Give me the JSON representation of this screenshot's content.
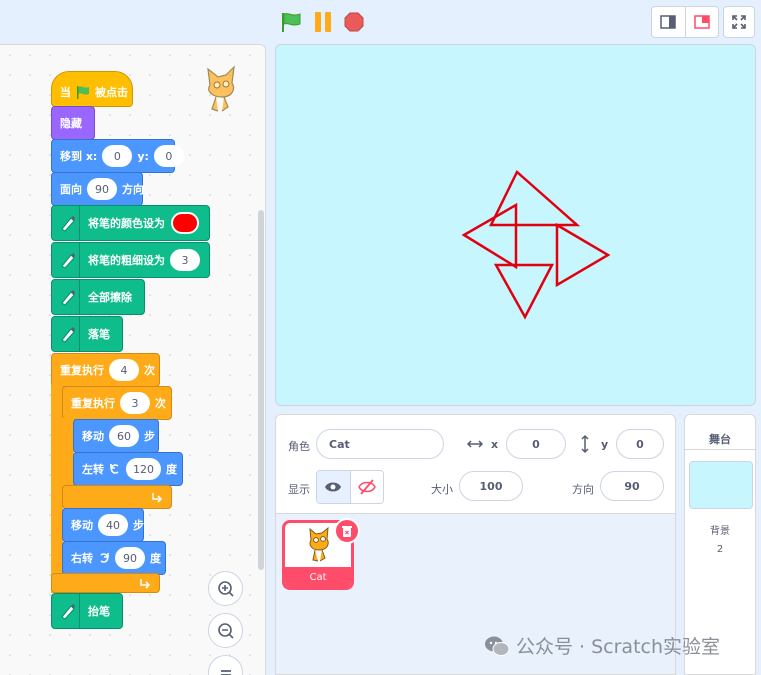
{
  "controls": {
    "green_flag": "green-flag-icon",
    "pause": "pause-icon",
    "stop": "stop-icon"
  },
  "blocks": {
    "when_flag": {
      "pre": "当",
      "post": "被点击"
    },
    "hide": "隐藏",
    "goto": {
      "label": "移到 x:",
      "x": "0",
      "ylabel": "y:",
      "y": "0"
    },
    "point": {
      "label": "面向",
      "value": "90",
      "suffix": "方向"
    },
    "set_color": {
      "label": "将笔的颜色设为",
      "color": "#ff0000"
    },
    "set_size": {
      "label": "将笔的粗细设为",
      "value": "3"
    },
    "erase": "全部擦除",
    "pen_down": "落笔",
    "repeat_outer": {
      "label": "重复执行",
      "value": "4",
      "suffix": "次"
    },
    "repeat_inner": {
      "label": "重复执行",
      "value": "3",
      "suffix": "次"
    },
    "move1": {
      "label": "移动",
      "value": "60",
      "suffix": "步"
    },
    "turn_left": {
      "label": "左转",
      "value": "120",
      "suffix": "度"
    },
    "move2": {
      "label": "移动",
      "value": "40",
      "suffix": "步"
    },
    "turn_right": {
      "label": "右转",
      "value": "90",
      "suffix": "度"
    },
    "pen_up": "抬笔"
  },
  "sprite_info": {
    "sprite_label": "角色",
    "sprite_name": "Cat",
    "x_label": "x",
    "x_value": "0",
    "y_label": "y",
    "y_value": "0",
    "show_label": "显示",
    "size_label": "大小",
    "size_value": "100",
    "direction_label": "方向",
    "direction_value": "90"
  },
  "sprites": [
    {
      "name": "Cat"
    }
  ],
  "stage_panel": {
    "title": "舞台",
    "backdrops_label": "背景",
    "backdrops_count": "2"
  },
  "watermark": "公众号 · Scratch实验室",
  "colors": {
    "accent": "#4c97ff",
    "pen": "#ff0000",
    "stage": "#c8f6ff",
    "sprite_selected": "#ff4c6a"
  }
}
